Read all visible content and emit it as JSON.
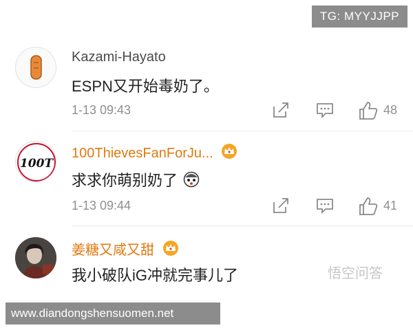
{
  "watermark_top": "TG: MYYJJPP",
  "watermark_bottom": "www.diandongshensuomen.net",
  "watermark_corner": "悟空问答",
  "comments": [
    {
      "username": "Kazami-Hayato",
      "text": "ESPN又开始毒奶了。",
      "time": "1-13 09:43",
      "likes": "48",
      "vip": false
    },
    {
      "username": "100ThievesFanForJu...",
      "text": "求求你萌别奶了",
      "time": "1-13 09:44",
      "likes": "41",
      "vip": true,
      "avatar_text": "100T"
    },
    {
      "username": "姜糖又咸又甜",
      "text": "我小破队iG冲就完事儿了",
      "vip": true
    }
  ]
}
